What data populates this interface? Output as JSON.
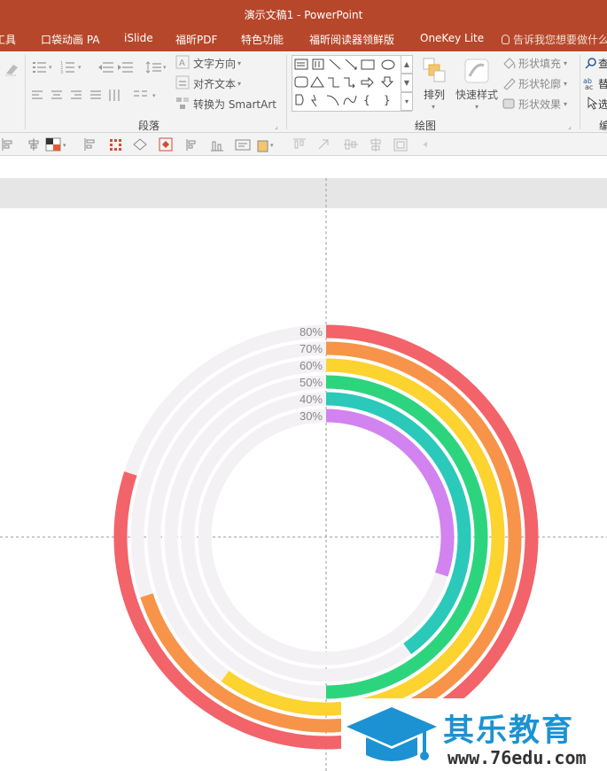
{
  "window": {
    "title": "演示文稿1 - PowerPoint"
  },
  "menu": {
    "items": [
      "工具",
      "口袋动画 PA",
      "iSlide",
      "福昕PDF",
      "特色功能",
      "福昕阅读器领鲜版",
      "OneKey Lite"
    ],
    "tell_me": "告诉我您想要做什么"
  },
  "ribbon": {
    "paragraph": {
      "label": "段落",
      "text_direction": "文字方向",
      "align_text": "对齐文本",
      "convert_smartart": "转换为 SmartArt"
    },
    "drawing": {
      "label": "绘图",
      "arrange": "排列",
      "quick_styles": "快速样式",
      "shape_fill": "形状填充",
      "shape_outline": "形状轮廓",
      "shape_effects": "形状效果"
    },
    "editing": {
      "find_char": "查",
      "replace_char": "替",
      "select_char": "选",
      "label_char": "编"
    }
  },
  "chart_data": {
    "type": "radial-bar",
    "categories": [
      "80%",
      "70%",
      "60%",
      "50%",
      "40%",
      "30%"
    ],
    "values": [
      80,
      70,
      60,
      50,
      40,
      30
    ],
    "max": 100,
    "colors": [
      "#f2636a",
      "#f79449",
      "#fcd32f",
      "#2dd47e",
      "#2ac9ba",
      "#d283f0"
    ],
    "track_color": "#f3f1f4"
  },
  "watermark": {
    "title": "其乐教育",
    "url": "www.76edu.com"
  }
}
